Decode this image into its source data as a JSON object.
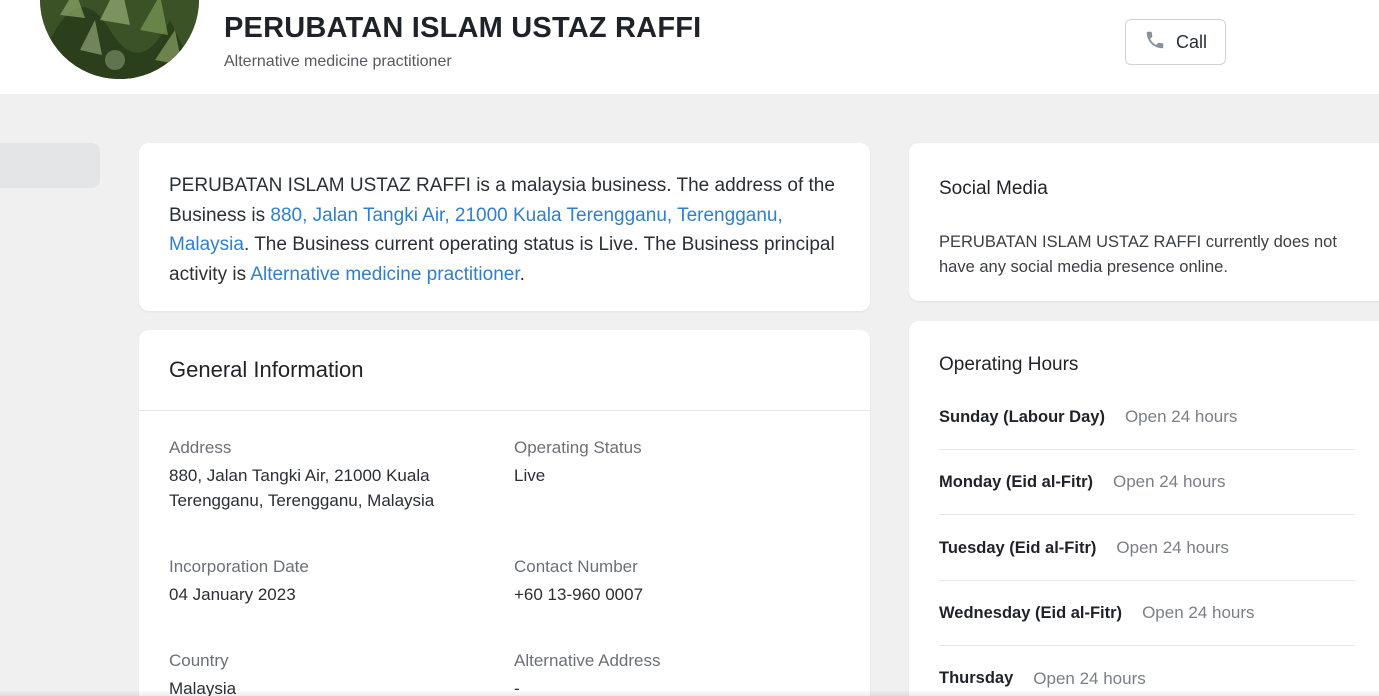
{
  "business": {
    "name": "PERUBATAN ISLAM USTAZ RAFFI",
    "category": "Alternative medicine practitioner"
  },
  "call_button": {
    "label": "Call",
    "icon": "phone-icon"
  },
  "intro": {
    "part1": "PERUBATAN ISLAM USTAZ RAFFI is a malaysia business. The address of the Business is ",
    "address_link": "880, Jalan Tangki Air, 21000 Kuala Terengganu, Terengganu, Malaysia",
    "part2": ". The Business current operating status is Live. The Business principal activity is ",
    "activity_link": "Alternative medicine practitioner",
    "part3": "."
  },
  "general_info": {
    "title": "General Information",
    "fields": {
      "address": {
        "label": "Address",
        "value": "880, Jalan Tangki Air, 21000 Kuala Terengganu, Terengganu, Malaysia"
      },
      "operating_status": {
        "label": "Operating Status",
        "value": "Live"
      },
      "incorporation_date": {
        "label": "Incorporation Date",
        "value": "04 January 2023"
      },
      "contact_number": {
        "label": "Contact Number",
        "value": "+60 13-960 0007"
      },
      "country": {
        "label": "Country",
        "value": "Malaysia"
      },
      "alternative_address": {
        "label": "Alternative Address",
        "value": "-"
      }
    }
  },
  "social_media": {
    "title": "Social Media",
    "text": "PERUBATAN ISLAM USTAZ RAFFI currently does not have any social media presence online."
  },
  "operating_hours": {
    "title": "Operating Hours",
    "rows": [
      {
        "day": "Sunday (Labour Day)",
        "time": "Open 24 hours"
      },
      {
        "day": "Monday (Eid al-Fitr)",
        "time": "Open 24 hours"
      },
      {
        "day": "Tuesday (Eid al-Fitr)",
        "time": "Open 24 hours"
      },
      {
        "day": "Wednesday (Eid al-Fitr)",
        "time": "Open 24 hours"
      },
      {
        "day": "Thursday",
        "time": "Open 24 hours"
      }
    ]
  },
  "colors": {
    "link": "#2f7fd1",
    "page_bg": "#f0f0f1",
    "card_bg": "#ffffff"
  }
}
